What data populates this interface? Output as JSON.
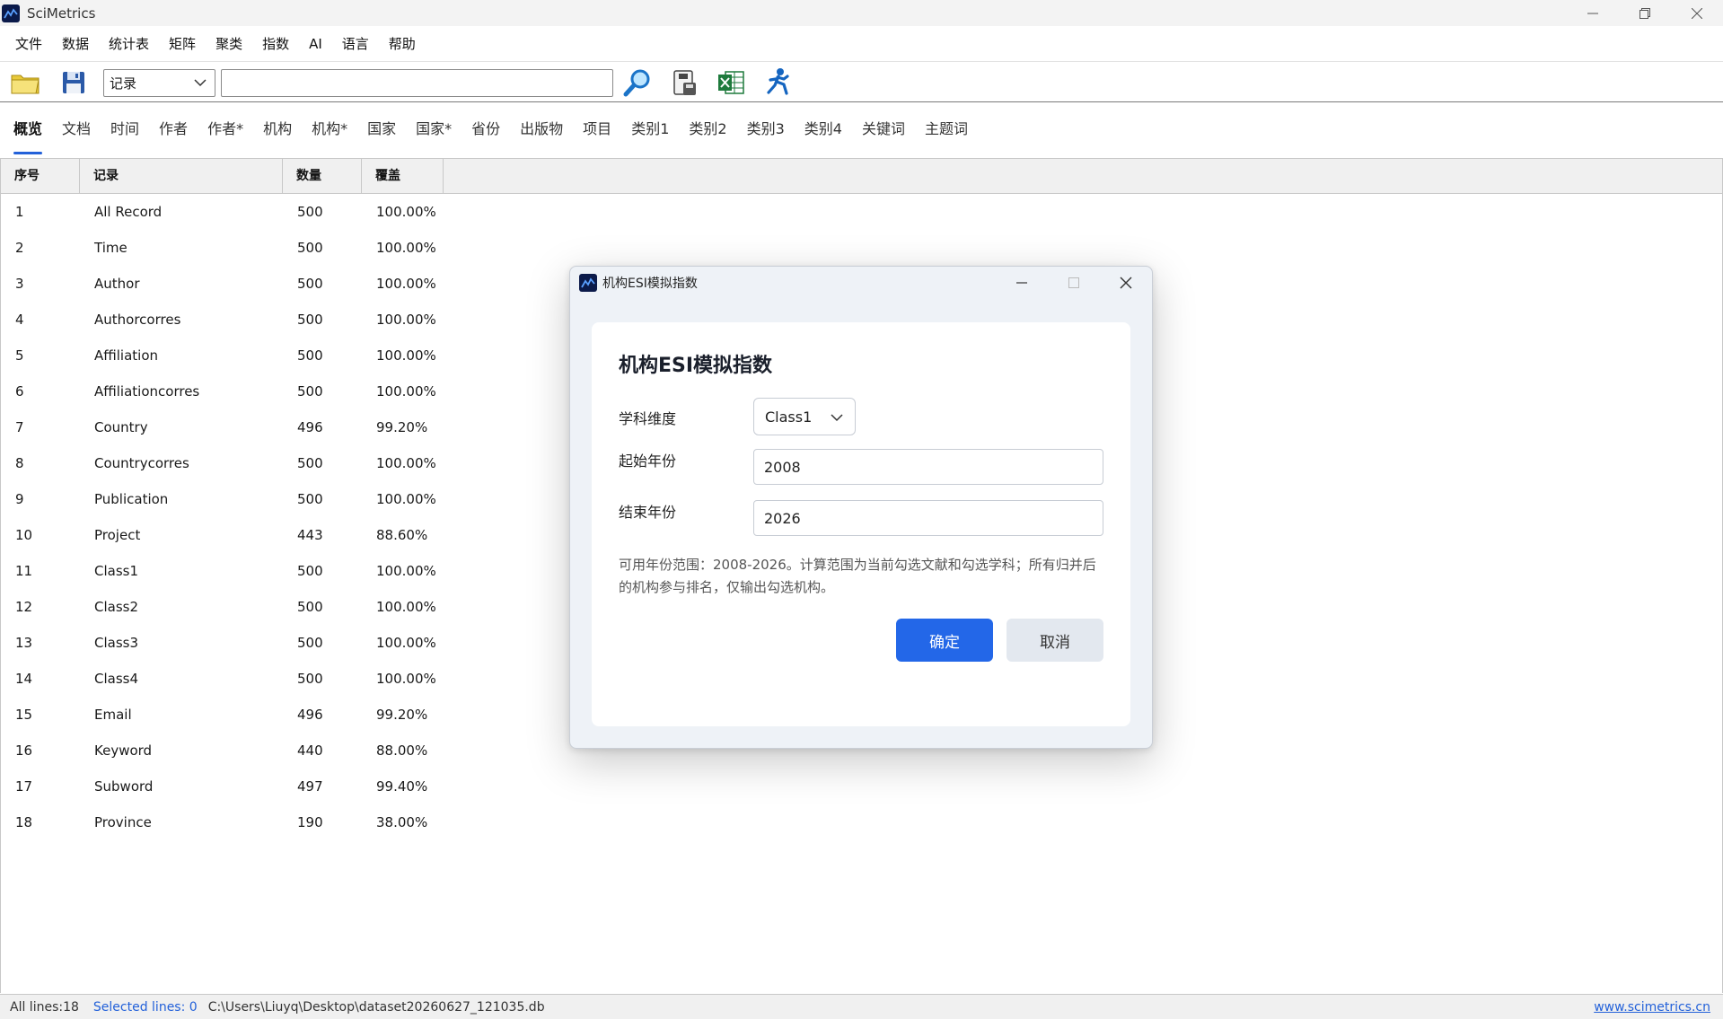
{
  "window": {
    "title": "SciMetrics",
    "controls": {
      "minimize": "—",
      "restore": "❐",
      "close": "✕"
    }
  },
  "menu": [
    "文件",
    "数据",
    "统计表",
    "矩阵",
    "聚类",
    "指数",
    "AI",
    "语言",
    "帮助"
  ],
  "toolbar": {
    "field_select_value": "记录",
    "search_value": "",
    "icons": [
      "open-folder-icon",
      "save-icon",
      "search-magnifier-icon",
      "database-save-icon",
      "excel-export-icon",
      "run-person-icon"
    ]
  },
  "tabs": [
    "概览",
    "文档",
    "时间",
    "作者",
    "作者*",
    "机构",
    "机构*",
    "国家",
    "国家*",
    "省份",
    "出版物",
    "项目",
    "类别1",
    "类别2",
    "类别3",
    "类别4",
    "关键词",
    "主题词"
  ],
  "table": {
    "columns": [
      "序号",
      "记录",
      "数量",
      "覆盖"
    ],
    "rows": [
      [
        "1",
        "All Record",
        "500",
        "100.00%"
      ],
      [
        "2",
        "Time",
        "500",
        "100.00%"
      ],
      [
        "3",
        "Author",
        "500",
        "100.00%"
      ],
      [
        "4",
        "Authorcorres",
        "500",
        "100.00%"
      ],
      [
        "5",
        "Affiliation",
        "500",
        "100.00%"
      ],
      [
        "6",
        "Affiliationcorres",
        "500",
        "100.00%"
      ],
      [
        "7",
        "Country",
        "496",
        "99.20%"
      ],
      [
        "8",
        "Countrycorres",
        "500",
        "100.00%"
      ],
      [
        "9",
        "Publication",
        "500",
        "100.00%"
      ],
      [
        "10",
        "Project",
        "443",
        "88.60%"
      ],
      [
        "11",
        "Class1",
        "500",
        "100.00%"
      ],
      [
        "12",
        "Class2",
        "500",
        "100.00%"
      ],
      [
        "13",
        "Class3",
        "500",
        "100.00%"
      ],
      [
        "14",
        "Class4",
        "500",
        "100.00%"
      ],
      [
        "15",
        "Email",
        "496",
        "99.20%"
      ],
      [
        "16",
        "Keyword",
        "440",
        "88.00%"
      ],
      [
        "17",
        "Subword",
        "497",
        "99.40%"
      ],
      [
        "18",
        "Province",
        "190",
        "38.00%"
      ]
    ]
  },
  "status": {
    "all_lines": "All lines:18",
    "selected_lines": "Selected lines: 0",
    "path": "C:\\Users\\Liuyq\\Desktop\\dataset20260627_121035.db",
    "link": "www.scimetrics.cn"
  },
  "dialog": {
    "window_title": "机构ESI模拟指数",
    "heading": "机构ESI模拟指数",
    "subject_label": "学科维度",
    "subject_value": "Class1",
    "start_label": "起始年份",
    "start_value": "2008",
    "end_label": "结束年份",
    "end_value": "2026",
    "note": "可用年份范围：2008-2026。计算范围为当前勾选文献和勾选学科；所有归并后的机构参与排名，仅输出勾选机构。",
    "ok_label": "确定",
    "cancel_label": "取消"
  },
  "colors": {
    "accent": "#2367e8",
    "link": "#2361d9",
    "header_bg": "#f0f0f0"
  }
}
